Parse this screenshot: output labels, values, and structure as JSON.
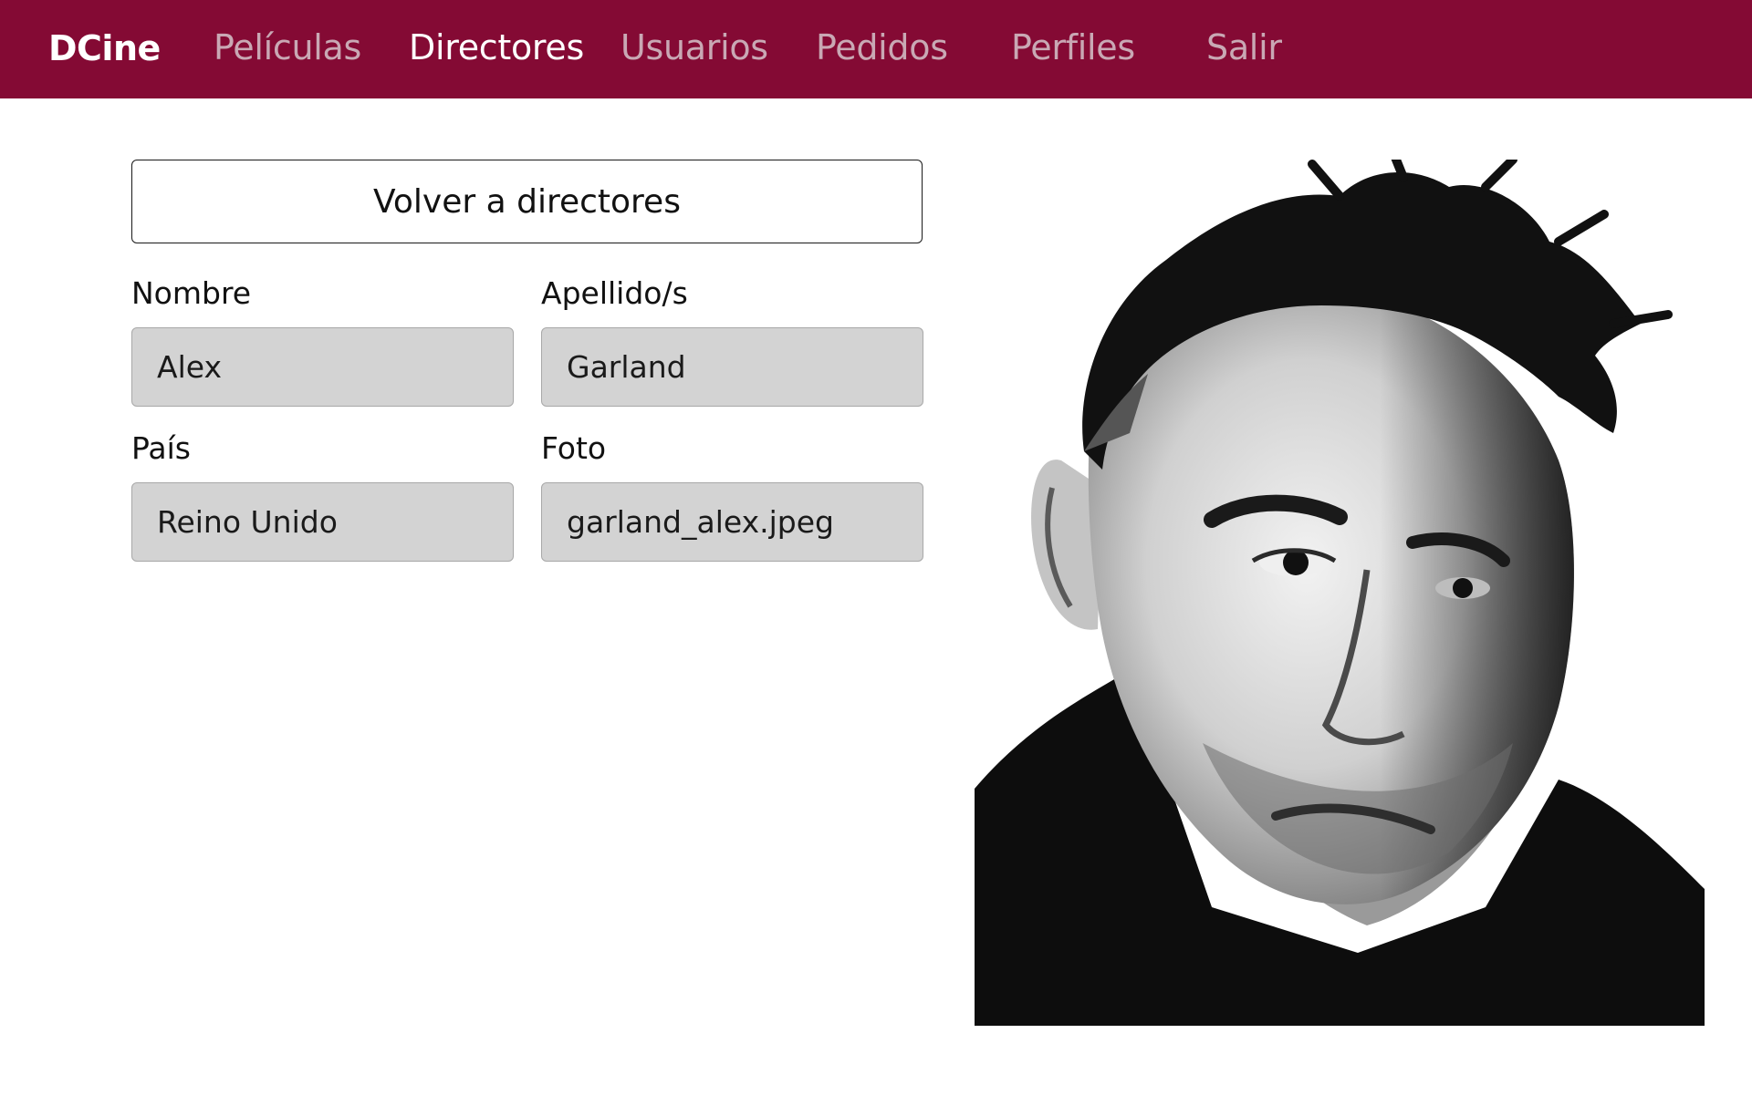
{
  "navbar": {
    "brand": "DCine",
    "links": [
      {
        "label": "Películas",
        "active": false
      },
      {
        "label": "Directores",
        "active": true
      },
      {
        "label": "Usuarios",
        "active": false
      },
      {
        "label": "Pedidos",
        "active": false
      },
      {
        "label": "Perfiles",
        "active": false
      },
      {
        "label": "Salir",
        "active": false
      }
    ]
  },
  "back_button": {
    "label": "Volver a directores"
  },
  "form": {
    "nombre": {
      "label": "Nombre",
      "value": "Alex"
    },
    "apellidos": {
      "label": "Apellido/s",
      "value": "Garland"
    },
    "pais": {
      "label": "País",
      "value": "Reino Unido"
    },
    "foto": {
      "label": "Foto",
      "value": "garland_alex.jpeg"
    }
  },
  "photo": {
    "icon": "director-portrait-photo"
  },
  "colors": {
    "navbar_bg": "#840a34",
    "nav_inactive": "#c9a8b4",
    "nav_active": "#ffffff",
    "input_bg": "#d3d3d3"
  }
}
